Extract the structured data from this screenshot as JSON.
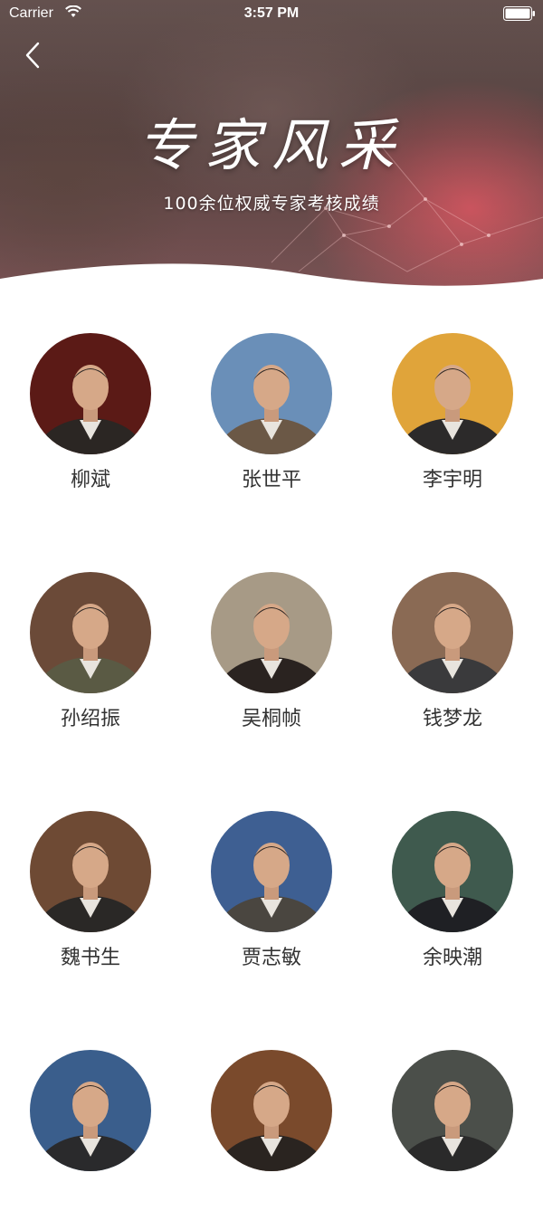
{
  "status_bar": {
    "carrier": "Carrier",
    "time": "3:57 PM"
  },
  "header": {
    "title": "专家风采",
    "subtitle": "100余位权威专家考核成绩",
    "back_icon": "chevron-left-icon"
  },
  "experts": [
    {
      "name": "柳斌",
      "bg": "#5b1a16",
      "suit": "#2b2623"
    },
    {
      "name": "张世平",
      "bg": "#6a8fb8",
      "suit": "#6b5846"
    },
    {
      "name": "李宇明",
      "bg": "#e0a43a",
      "suit": "#2c2a2a"
    },
    {
      "name": "孙绍振",
      "bg": "#6b4a38",
      "suit": "#5a5a44"
    },
    {
      "name": "吴桐帧",
      "bg": "#a79a86",
      "suit": "#2a2320"
    },
    {
      "name": "钱梦龙",
      "bg": "#8a6a54",
      "suit": "#3a3a3c"
    },
    {
      "name": "魏书生",
      "bg": "#6e4a34",
      "suit": "#2a2826"
    },
    {
      "name": "贾志敏",
      "bg": "#3e5f92",
      "suit": "#4a4640"
    },
    {
      "name": "余映潮",
      "bg": "#3f5a4e",
      "suit": "#1f2024"
    },
    {
      "name": "",
      "bg": "#3a5e8c",
      "suit": "#2a2a2c"
    },
    {
      "name": "",
      "bg": "#7a4a2c",
      "suit": "#2a2420"
    },
    {
      "name": "",
      "bg": "#4b4f4a",
      "suit": "#2a2a2a"
    }
  ]
}
